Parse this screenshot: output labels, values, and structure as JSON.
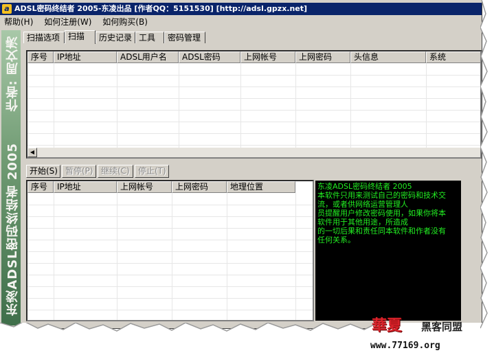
{
  "window": {
    "title": "ADSL密码终结者 2005-东凌出品 [作者QQ：5151530] [http://adsl.gpzx.net]"
  },
  "menu": [
    "帮助(H)",
    "如何注册(W)",
    "如何购买(B)"
  ],
  "sidebar": {
    "author": "作者: 周文涛",
    "product": "东凌ADSL密码终结者 2005"
  },
  "tabs": [
    {
      "label": "扫描选项",
      "active": false
    },
    {
      "label": "扫描",
      "active": true
    },
    {
      "label": "历史记录",
      "active": false
    },
    {
      "label": "工具",
      "active": false
    },
    {
      "label": "密码管理",
      "active": false
    }
  ],
  "results_table": {
    "columns": [
      "序号",
      "IP地址",
      "ADSL用户名",
      "ADSL密码",
      "上网帐号",
      "上网密码",
      "头信息",
      "系统"
    ]
  },
  "buttons": [
    {
      "label": "开始(S)",
      "enabled": true
    },
    {
      "label": "暂停(P)",
      "enabled": false
    },
    {
      "label": "继续(C)",
      "enabled": false
    },
    {
      "label": "停止(T)",
      "enabled": false
    }
  ],
  "host_table": {
    "columns": [
      "序号",
      "IP地址",
      "上网帐号",
      "上网密码",
      "地理位置"
    ]
  },
  "info_panel": {
    "lines": [
      "东凌ADSL密码终结者 2005",
      "本软件只用来测试自己的密码和技术交",
      "流，或者供网络运营管理人",
      "员提醒用户修改密码使用，如果你将本",
      "软件用于其他用途，所造成",
      "的一切后果和责任同本软件和作者没有",
      "任何关系。"
    ],
    "text_color": "#22ee22",
    "background": "#000000"
  },
  "watermark": {
    "brand": "華夏",
    "sub": "黑客同盟",
    "url": "www.77169.org"
  },
  "colors": {
    "titlebar": "#0a246a",
    "face": "#d4d0c8"
  }
}
